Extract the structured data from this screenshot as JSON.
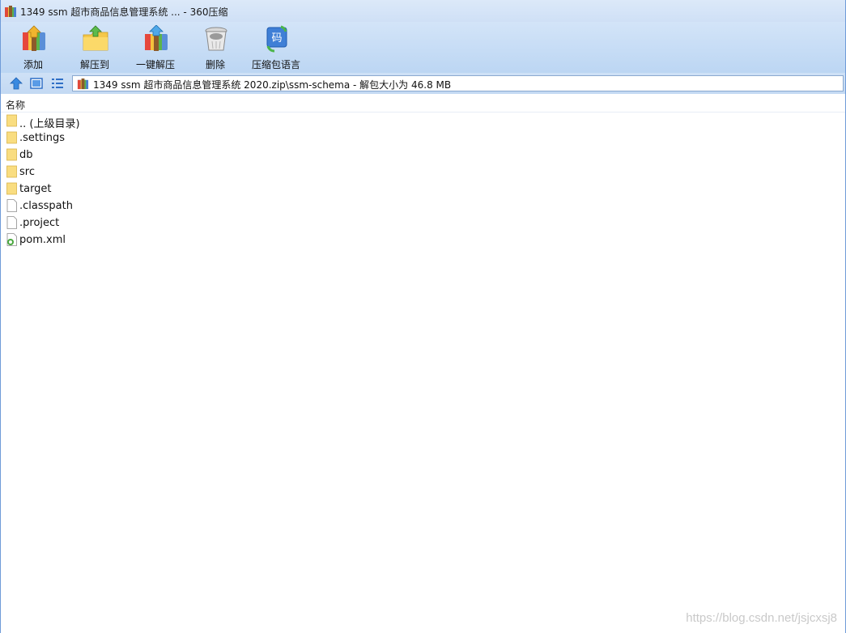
{
  "window": {
    "title": "1349 ssm 超市商品信息管理系统  ... - 360压缩"
  },
  "toolbar": {
    "buttons": [
      {
        "label": "添加",
        "icon": "add-archive-icon"
      },
      {
        "label": "解压到",
        "icon": "extract-to-icon"
      },
      {
        "label": "一键解压",
        "icon": "one-click-extract-icon"
      },
      {
        "label": "删除",
        "icon": "trash-can-icon"
      },
      {
        "label": "压缩包语言",
        "icon": "archive-language-icon"
      }
    ]
  },
  "address": {
    "path": "1349 ssm 超市商品信息管理系统  2020.zip\\ssm-schema - 解包大小为 46.8 MB"
  },
  "list": {
    "column_name": "名称",
    "items": [
      {
        "name": ".. (上级目录)",
        "type": "folder"
      },
      {
        "name": ".settings",
        "type": "folder"
      },
      {
        "name": "db",
        "type": "folder"
      },
      {
        "name": "src",
        "type": "folder"
      },
      {
        "name": "target",
        "type": "folder"
      },
      {
        "name": ".classpath",
        "type": "file"
      },
      {
        "name": ".project",
        "type": "file"
      },
      {
        "name": "pom.xml",
        "type": "xml"
      }
    ]
  },
  "watermark": "https://blog.csdn.net/jsjcxsj8",
  "colors": {
    "accent": "#3a7bd5",
    "folder": "#f7d774",
    "toolbar_bg": "#c9ddf5"
  }
}
